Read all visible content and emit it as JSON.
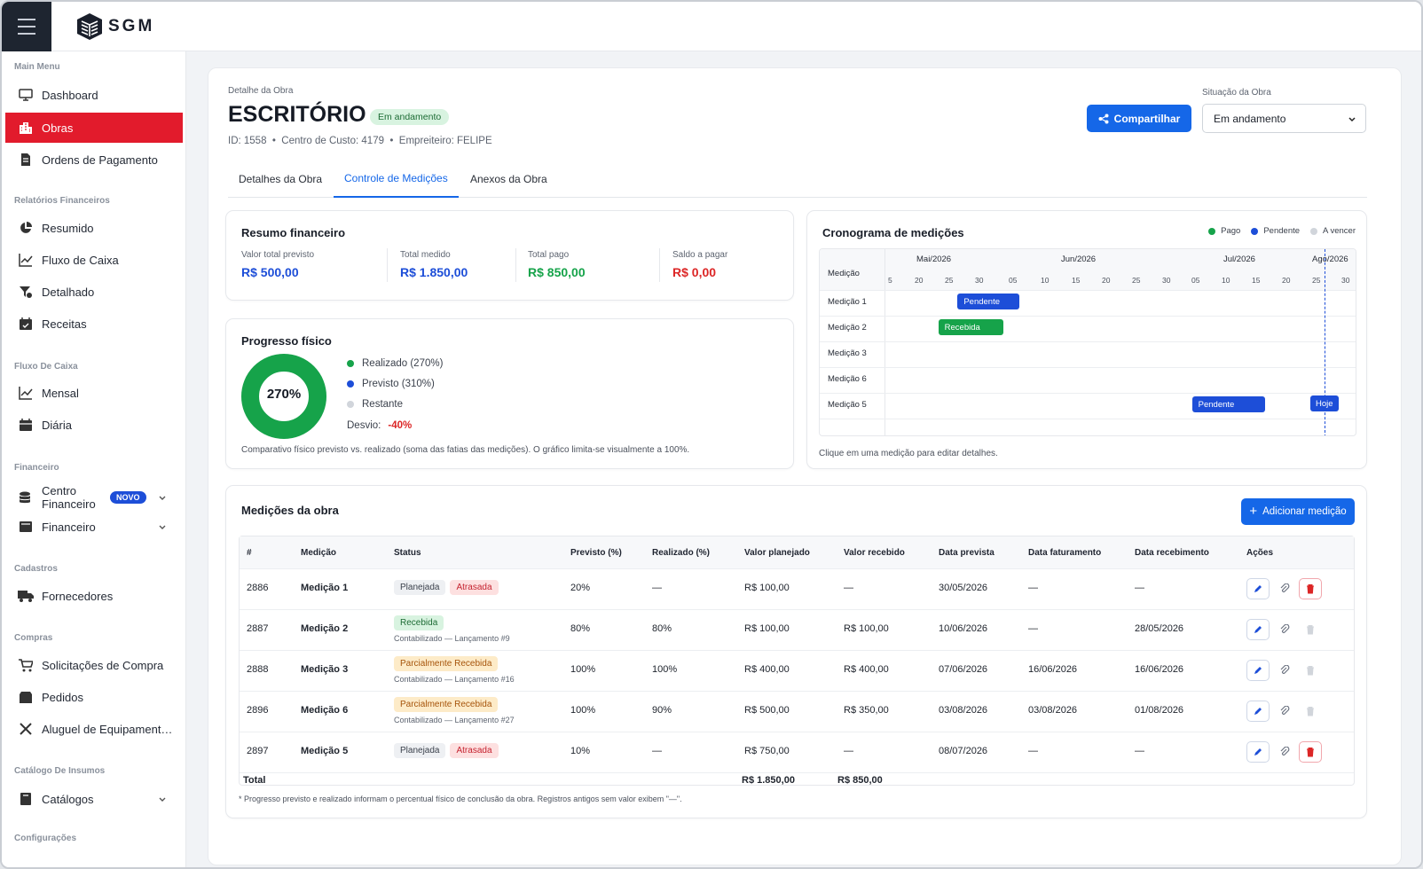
{
  "app": {
    "logo_text": "SGM"
  },
  "sidebar": {
    "sections": {
      "main_menu": "Main Menu",
      "relatorios": "Relatórios Financeiros",
      "fluxo": "Fluxo De Caixa",
      "financeiro": "Financeiro",
      "cadastros": "Cadastros",
      "compras": "Compras",
      "catalogo": "Catálogo De Insumos",
      "config": "Configurações"
    },
    "items": {
      "dashboard": "Dashboard",
      "obras": "Obras",
      "ordens": "Ordens de Pagamento",
      "resumido": "Resumido",
      "fluxo_caixa": "Fluxo de Caixa",
      "detalhado": "Detalhado",
      "receitas": "Receitas",
      "mensal": "Mensal",
      "diaria": "Diária",
      "centro_1": "Centro",
      "centro_2": "Financeiro",
      "novo": "NOVO",
      "financeiro": "Financeiro",
      "fornecedores": "Fornecedores",
      "solicitacoes": "Solicitações de Compra",
      "pedidos": "Pedidos",
      "aluguel": "Aluguel de Equipament…",
      "catalogos": "Catálogos"
    }
  },
  "header": {
    "breadcrumb": "Detalhe da Obra",
    "title": "ESCRITÓRIO",
    "status": "Em andamento",
    "meta": "ID: 1558  •  Centro de Custo: 4179  •  Empreiteiro: FELIPE",
    "share": "Compartilhar",
    "situacao_label": "Situação da Obra",
    "situacao_value": "Em andamento"
  },
  "tabs": [
    "Detalhes da Obra",
    "Controle de Medições",
    "Anexos da Obra"
  ],
  "resumo": {
    "title": "Resumo financeiro",
    "cols": [
      {
        "label": "Valor total previsto",
        "value": "R$ 500,00",
        "color": "#1d4ed8"
      },
      {
        "label": "Total medido",
        "value": "R$ 1.850,00",
        "color": "#1d4ed8"
      },
      {
        "label": "Total pago",
        "value": "R$ 850,00",
        "color": "#16a34a"
      },
      {
        "label": "Saldo a pagar",
        "value": "R$ 0,00",
        "color": "#dc2626"
      }
    ]
  },
  "progresso": {
    "title": "Progresso físico",
    "center": "270%",
    "fill_fraction": 1.0,
    "realizado": "Realizado (270%)",
    "previsto": "Previsto (310%)",
    "restante": "Restante",
    "desvio_label": "Desvio:",
    "desvio_value": "-40%",
    "note": "Comparativo físico previsto vs. realizado (soma das fatias das medições). O gráfico limita-se visualmente a 100%."
  },
  "cronograma": {
    "title": "Cronograma de medições",
    "legend": [
      "Pago",
      "Pendente",
      "A vencer"
    ],
    "col_header": "Medição",
    "months": [
      "Mai/2026",
      "Jun/2026",
      "Jul/2026",
      "Ago/2026"
    ],
    "days": [
      "5",
      "20",
      "25",
      "30",
      "05",
      "10",
      "15",
      "20",
      "25",
      "30",
      "05",
      "10",
      "15",
      "20",
      "25",
      "30"
    ],
    "rows": [
      "Medição 1",
      "Medição 2",
      "Medição 3",
      "Medição 6",
      "Medição 5"
    ],
    "bars": [
      {
        "row": 0,
        "label": "Pendente",
        "status": "pendente",
        "start": "2026-05-20",
        "end": "2026-06-05"
      },
      {
        "row": 1,
        "label": "Recebida",
        "status": "pago",
        "start": "2026-05-15",
        "end": "2026-06-01"
      },
      {
        "row": 4,
        "label": "Pendente",
        "status": "pendente",
        "start": "2026-07-20",
        "end": "2026-08-08"
      }
    ],
    "today_label": "Hoje",
    "footer": "Clique em uma medição para editar detalhes.",
    "colors": {
      "pago": "#16a34a",
      "pendente": "#1d4ed8",
      "avencer": "#d1d5db"
    }
  },
  "medicoes": {
    "title": "Medições da obra",
    "add_button": "Adicionar medição",
    "headers": [
      "#",
      "Medição",
      "Status",
      "Previsto (%)",
      "Realizado (%)",
      "Valor planejado",
      "Valor recebido",
      "Data prevista",
      "Data faturamento",
      "Data recebimento",
      "Ações"
    ],
    "rows": [
      {
        "id": "2886",
        "nome": "Medição 1",
        "tags": [
          {
            "t": "Planejada",
            "c": "gray"
          },
          {
            "t": "Atrasada",
            "c": "red"
          }
        ],
        "sub": "",
        "prev": "20%",
        "real": "—",
        "vp": "R$ 100,00",
        "vr": "—",
        "dp": "30/05/2026",
        "df": "—",
        "dr": "—",
        "del": true
      },
      {
        "id": "2887",
        "nome": "Medição 2",
        "tags": [
          {
            "t": "Recebida",
            "c": "green"
          }
        ],
        "sub": "Contabilizado — Lançamento #9",
        "prev": "80%",
        "real": "80%",
        "vp": "R$ 100,00",
        "vr": "R$ 100,00",
        "dp": "10/06/2026",
        "df": "—",
        "dr": "28/05/2026",
        "del": false
      },
      {
        "id": "2888",
        "nome": "Medição 3",
        "tags": [
          {
            "t": "Parcialmente Recebida",
            "c": "orange"
          }
        ],
        "sub": "Contabilizado — Lançamento #16",
        "prev": "100%",
        "real": "100%",
        "vp": "R$ 400,00",
        "vr": "R$ 400,00",
        "dp": "07/06/2026",
        "df": "16/06/2026",
        "dr": "16/06/2026",
        "del": false
      },
      {
        "id": "2896",
        "nome": "Medição 6",
        "tags": [
          {
            "t": "Parcialmente Recebida",
            "c": "orange"
          }
        ],
        "sub": "Contabilizado — Lançamento #27",
        "prev": "100%",
        "real": "90%",
        "vp": "R$ 500,00",
        "vr": "R$ 350,00",
        "dp": "03/08/2026",
        "df": "03/08/2026",
        "dr": "01/08/2026",
        "del": false
      },
      {
        "id": "2897",
        "nome": "Medição 5",
        "tags": [
          {
            "t": "Planejada",
            "c": "gray"
          },
          {
            "t": "Atrasada",
            "c": "red"
          }
        ],
        "sub": "",
        "prev": "10%",
        "real": "—",
        "vp": "R$ 750,00",
        "vr": "—",
        "dp": "08/07/2026",
        "df": "—",
        "dr": "—",
        "del": true
      }
    ],
    "total_label": "Total",
    "total_planejado": "R$ 1.850,00",
    "total_recebido": "R$ 850,00",
    "footnote": "* Progresso previsto e realizado informam o percentual físico de conclusão da obra. Registros antigos sem valor exibem \"—\"."
  }
}
